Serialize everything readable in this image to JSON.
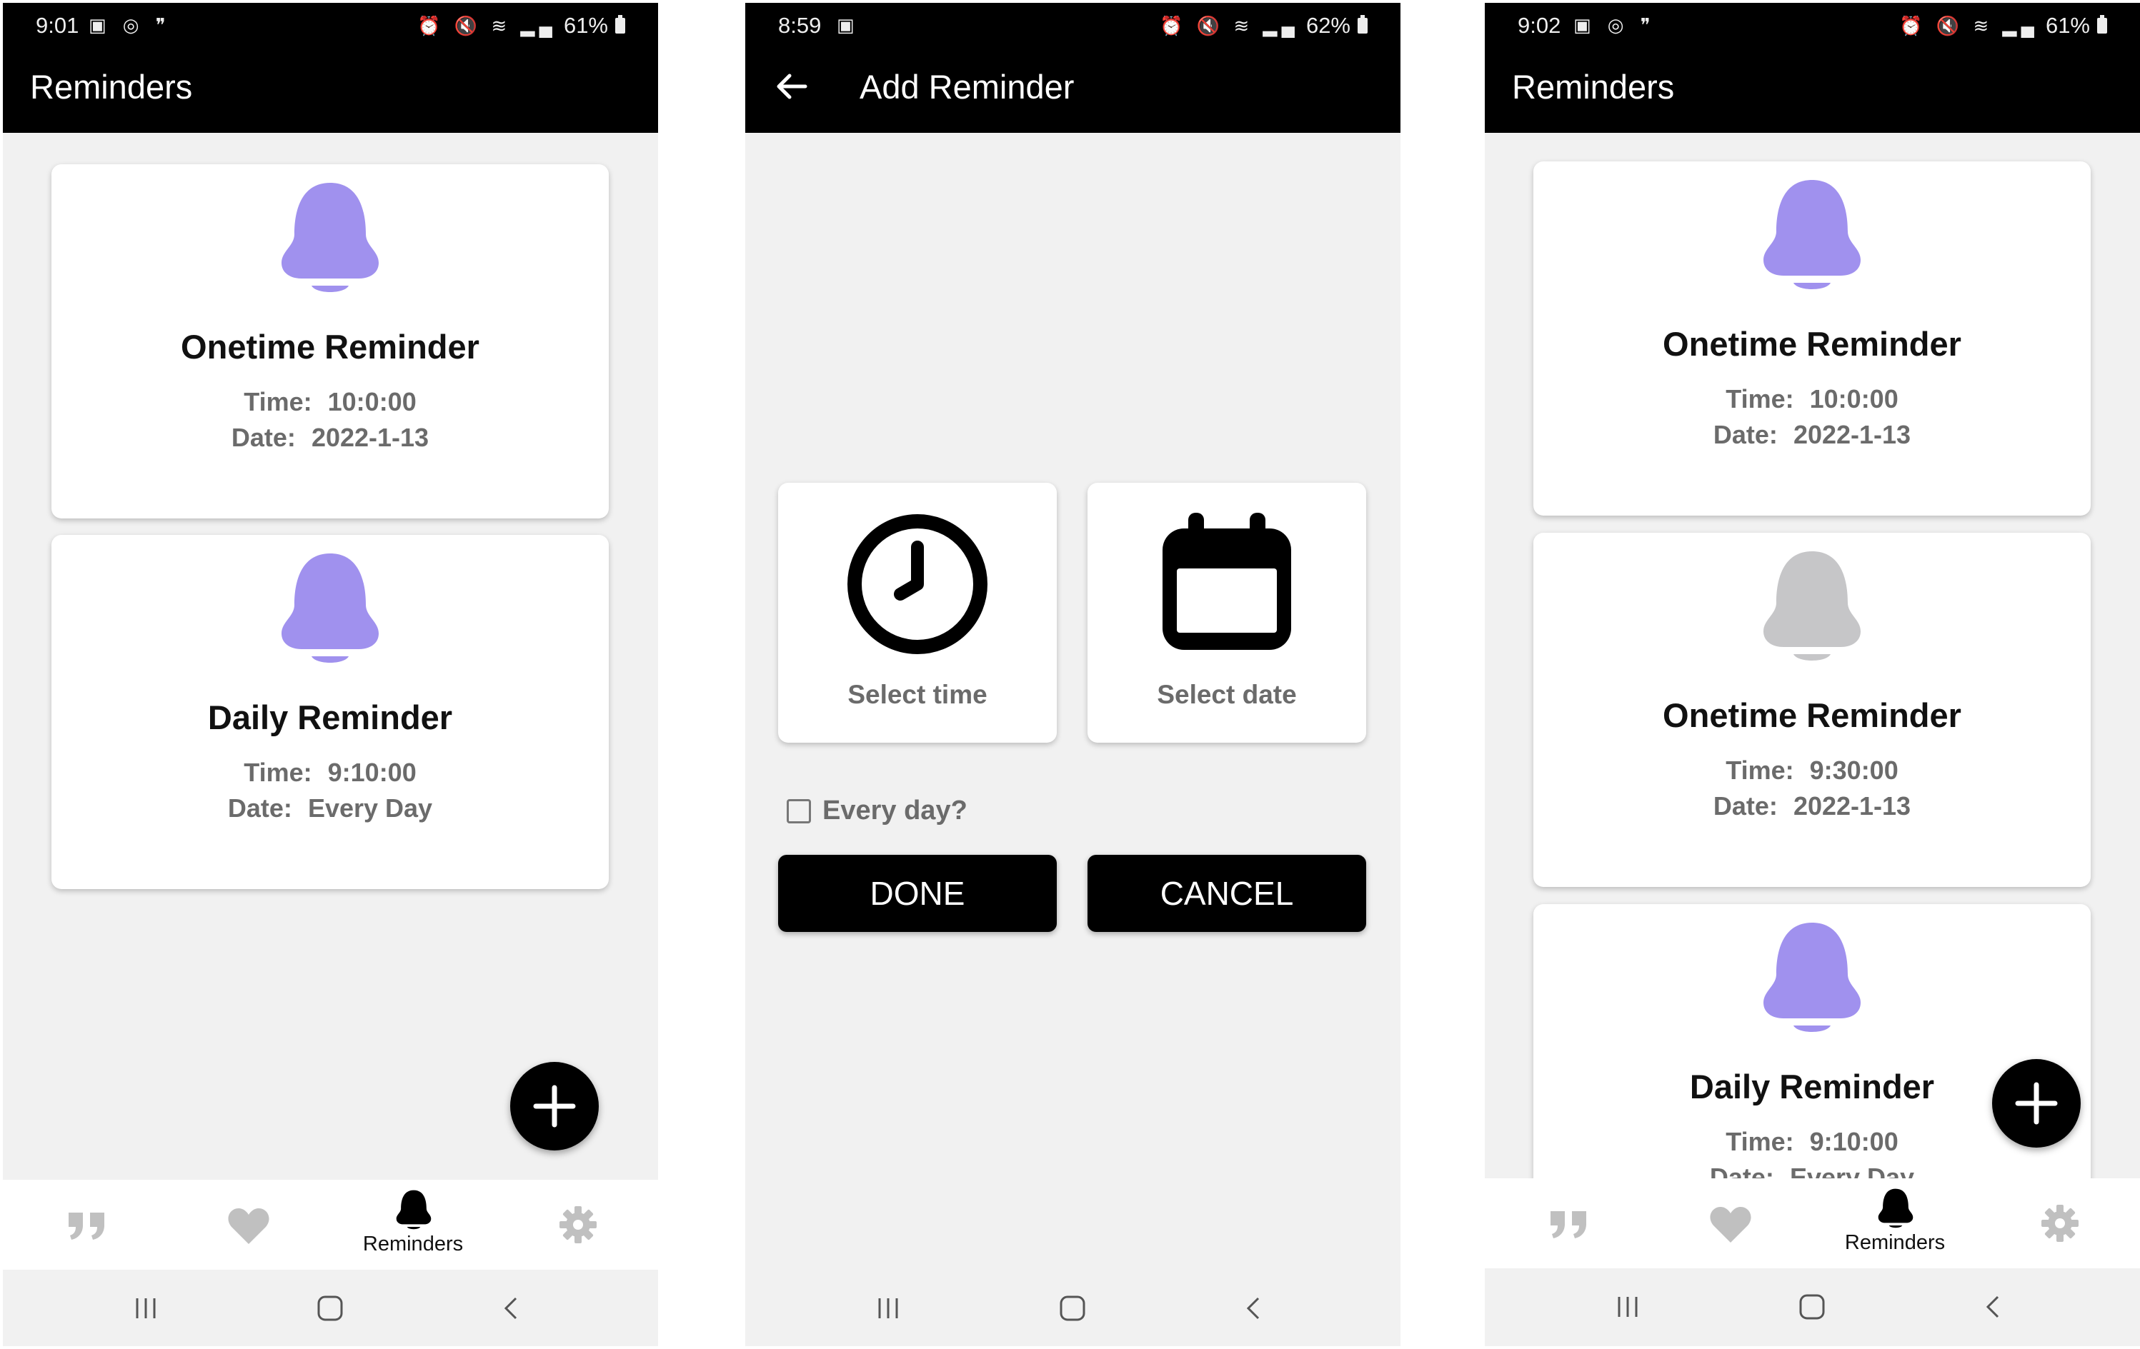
{
  "colors": {
    "accent_bell": "#a091ee",
    "disabled_bell": "#c6c6c8",
    "bar": "#000000",
    "background": "#f1f1f1",
    "nav_icon_inactive": "#c0c0c0"
  },
  "screens": [
    {
      "status": {
        "time": "9:01",
        "battery": "61%"
      },
      "title": "Reminders",
      "cards": [
        {
          "title": "Onetime Reminder",
          "time_label": "Time:",
          "time": "10:0:00",
          "date_label": "Date:",
          "date": "2022-1-13",
          "bell": "purple-bell-icon"
        },
        {
          "title": "Daily Reminder",
          "time_label": "Time:",
          "time": "9:10:00",
          "date_label": "Date:",
          "date": "Every Day",
          "bell": "purple-bell-icon"
        }
      ],
      "nav": [
        {
          "icon": "quote-icon"
        },
        {
          "icon": "heart-icon"
        },
        {
          "icon": "bell-icon",
          "label": "Reminders"
        },
        {
          "icon": "gear-icon"
        }
      ]
    },
    {
      "status": {
        "time": "8:59",
        "battery": "62%"
      },
      "title": "Add Reminder",
      "select_time": "Select time",
      "select_date": "Select date",
      "every_day": "Every day?",
      "done": "DONE",
      "cancel": "CANCEL"
    },
    {
      "status": {
        "time": "9:02",
        "battery": "61%"
      },
      "title": "Reminders",
      "cards": [
        {
          "title": "Onetime Reminder",
          "time_label": "Time:",
          "time": "10:0:00",
          "date_label": "Date:",
          "date": "2022-1-13",
          "bell": "purple-bell-icon"
        },
        {
          "title": "Onetime Reminder",
          "time_label": "Time:",
          "time": "9:30:00",
          "date_label": "Date:",
          "date": "2022-1-13",
          "bell": "gray-bell-icon"
        },
        {
          "title": "Daily Reminder",
          "time_label": "Time:",
          "time": "9:10:00",
          "date_label": "Date:",
          "date": "Every Day",
          "bell": "purple-bell-icon"
        }
      ],
      "nav": [
        {
          "icon": "quote-icon"
        },
        {
          "icon": "heart-icon"
        },
        {
          "icon": "bell-icon",
          "label": "Reminders"
        },
        {
          "icon": "gear-icon"
        }
      ]
    }
  ]
}
